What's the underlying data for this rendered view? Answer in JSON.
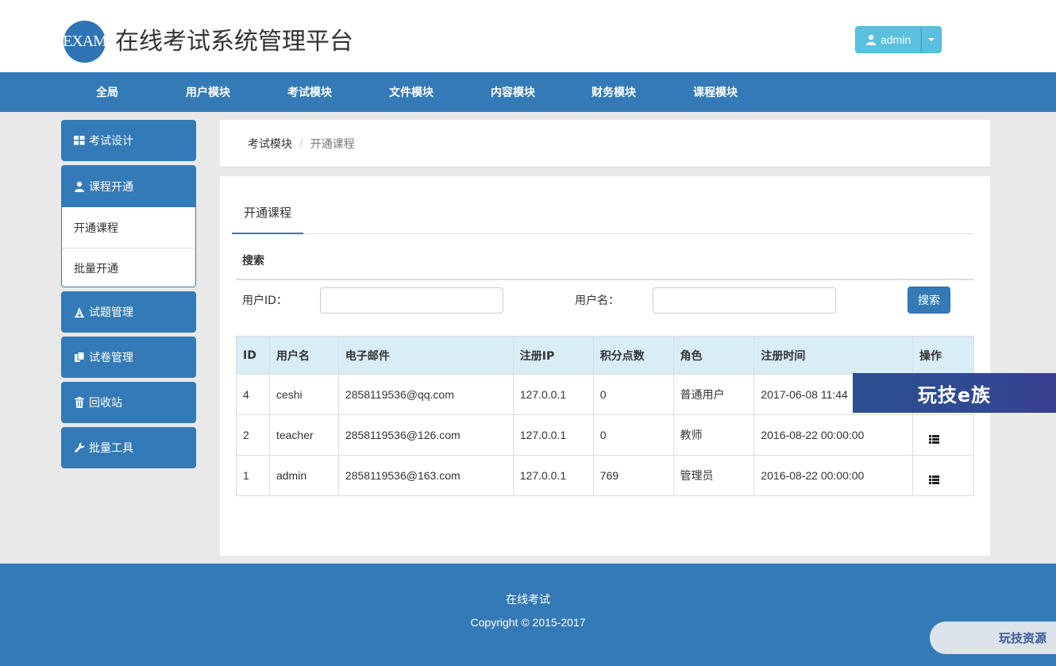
{
  "header": {
    "logo_text": "EXAM",
    "title": "在线考试系统管理平台",
    "user_label": "admin"
  },
  "nav": {
    "items": [
      "全局",
      "用户模块",
      "考试模块",
      "文件模块",
      "内容模块",
      "财务模块",
      "课程模块"
    ]
  },
  "sidebar": {
    "exam_design": "考试设计",
    "course_open": "课程开通",
    "course_open_sub": [
      "开通课程",
      "批量开通"
    ],
    "question_mgmt": "试题管理",
    "paper_mgmt": "试卷管理",
    "recycle": "回收站",
    "batch_tools": "批量工具"
  },
  "breadcrumb": {
    "parent": "考试模块",
    "current": "开通课程"
  },
  "main": {
    "tab": "开通课程",
    "search_title": "搜索",
    "user_id_label": "用户ID：",
    "user_name_label": "用户名：",
    "search_button": "搜索"
  },
  "table": {
    "headers": [
      "ID",
      "用户名",
      "电子邮件",
      "注册IP",
      "积分点数",
      "角色",
      "注册时间",
      "操作"
    ],
    "rows": [
      [
        "4",
        "ceshi",
        "2858119536@qq.com",
        "127.0.0.1",
        "0",
        "普通用户",
        "2017-06-08 11:44"
      ],
      [
        "2",
        "teacher",
        "2858119536@126.com",
        "127.0.0.1",
        "0",
        "教师",
        "2016-08-22 00:00:00"
      ],
      [
        "1",
        "admin",
        "2858119536@163.com",
        "127.0.0.1",
        "769",
        "管理员",
        "2016-08-22 00:00:00"
      ]
    ]
  },
  "footer": {
    "line1": "在线考试",
    "line2": "Copyright © 2015-2017"
  },
  "overlays": {
    "banner_text": "玩技e族",
    "corner_text": "玩技资源"
  },
  "colors": {
    "primary": "#337ab7",
    "info": "#5bc0de",
    "table_header": "#d9edf7"
  }
}
